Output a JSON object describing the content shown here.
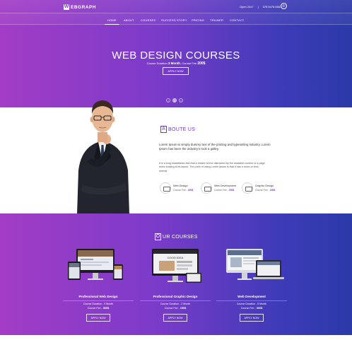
{
  "brand": {
    "logo_letter": "W",
    "logo_text": "EBGRAPH"
  },
  "top_contact": {
    "hours": "Open 24x7",
    "phone": "378 5478 6587",
    "phone_icon": "phone-icon"
  },
  "nav": [
    "HOME",
    "ABOUT",
    "COURSES",
    "SUCCESS STORY",
    "PRICING",
    "TRAINER",
    "CONTACT"
  ],
  "hero": {
    "title": "WEB DESIGN COURSES",
    "sub_prefix": "Course Duration",
    "duration": "3 Month",
    "fee_label": ", Course Fee",
    "fee": "200$",
    "button": "APPLY NOW",
    "dots": [
      "‹",
      "2",
      "›"
    ]
  },
  "about": {
    "title_first": "A",
    "title_rest": "BOUTE US",
    "text1": "Lorem Ipsum is simply dummy text of the printing and typesetting industry. Lorem Ipsum has been the industry's took a galley.",
    "text2": "It is a long established fact that a reader will be distracted by the readable content of a page when looking at its layout. The point of using Lorem Ipsum is that it has a more-or-less normal",
    "services": [
      {
        "name": "Web Design",
        "fee_label": "Course Fee -",
        "fee": "200$"
      },
      {
        "name": "Web Development",
        "fee_label": "Course Fee -",
        "fee": "200$"
      },
      {
        "name": "Graphic Design",
        "fee_label": "Course Fee -",
        "fee": "150$"
      }
    ]
  },
  "courses": {
    "title_first": "O",
    "title_rest": "UR COURSES",
    "items": [
      {
        "name": "Professional Web Design",
        "duration": "Course Duration - 3 Month",
        "fee_label": "Course Fee -",
        "fee": "300$",
        "button": "APPLY NOW"
      },
      {
        "name": "Professional Graphic Design",
        "duration": "Course Duration - 2 Month",
        "fee_label": "Course Fee -",
        "fee": "150$",
        "button": "APPLY NOW"
      },
      {
        "name": "Web Development",
        "duration": "Course Duration - 5 Month",
        "fee_label": "Course Fee -",
        "fee": "300$",
        "button": "APPLY NOW"
      }
    ],
    "screen_headline": "GOOD IDEA"
  },
  "colors": {
    "gradient_start": "#a33cc6",
    "gradient_mid": "#7a3bc9",
    "gradient_end": "#2b3aa8",
    "accent": "#6c3bc9"
  }
}
